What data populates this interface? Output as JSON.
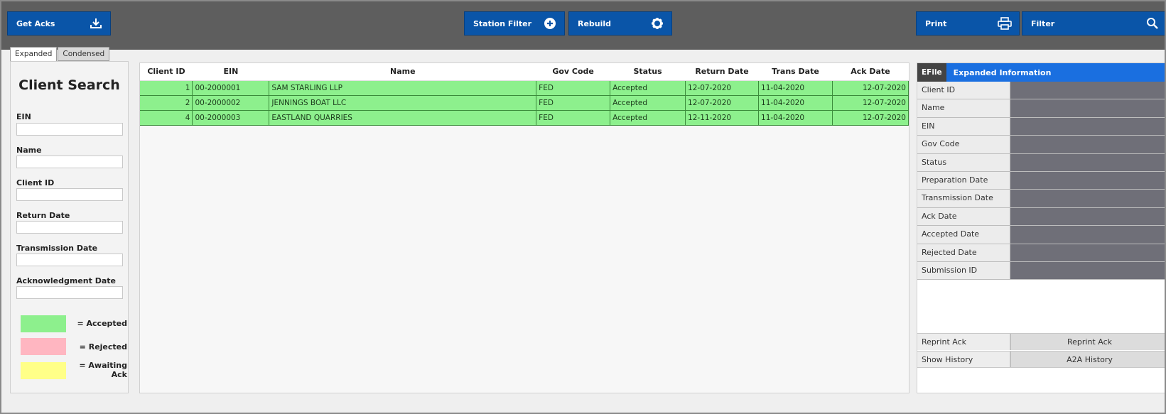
{
  "toolbar": {
    "get_acks": "Get Acks",
    "station_filter": "Station Filter",
    "rebuild": "Rebuild",
    "print": "Print",
    "filter": "Filter"
  },
  "tabs": [
    {
      "label": "Expanded",
      "active": true
    },
    {
      "label": "Condensed",
      "active": false
    }
  ],
  "search": {
    "title": "Client Search",
    "fields": [
      "EIN",
      "Name",
      "Client ID",
      "Return Date",
      "Transmission Date",
      "Acknowledgment Date"
    ]
  },
  "legend": [
    {
      "label": "= Accepted",
      "color": "#8df08d"
    },
    {
      "label": "= Rejected",
      "color": "#ffb6c1"
    },
    {
      "label": "= Awaiting Ack",
      "color": "#ffff88"
    }
  ],
  "grid": {
    "columns": [
      "Client ID",
      "EIN",
      "Name",
      "Gov Code",
      "Status",
      "Return Date",
      "Trans Date",
      "Ack Date"
    ],
    "rows": [
      [
        "1",
        "00-2000001",
        "SAM STARLING LLP",
        "FED",
        "Accepted",
        "12-07-2020",
        "11-04-2020",
        "12-07-2020"
      ],
      [
        "2",
        "00-2000002",
        "JENNINGS BOAT LLC",
        "FED",
        "Accepted",
        "12-07-2020",
        "11-04-2020",
        "12-07-2020"
      ],
      [
        "4",
        "00-2000003",
        "EASTLAND QUARRIES",
        "FED",
        "Accepted",
        "12-11-2020",
        "11-04-2020",
        "12-07-2020"
      ]
    ]
  },
  "details": {
    "efile_label": "EFile",
    "title": "Expanded Information",
    "fields": [
      "Client ID",
      "Name",
      "EIN",
      "Gov Code",
      "Status",
      "Preparation Date",
      "Transmission Date",
      "Ack Date",
      "Accepted Date",
      "Rejected Date",
      "Submission ID"
    ],
    "actions": [
      {
        "label": "Reprint Ack",
        "button": "Reprint Ack"
      },
      {
        "label": "Show History",
        "button": "A2A History"
      }
    ]
  },
  "colors": {
    "toolbar_bg": "#5e5e5e",
    "button_blue": "#0a55a8",
    "accepted_green": "#8df08d",
    "header_blue": "#1a6fe0"
  }
}
